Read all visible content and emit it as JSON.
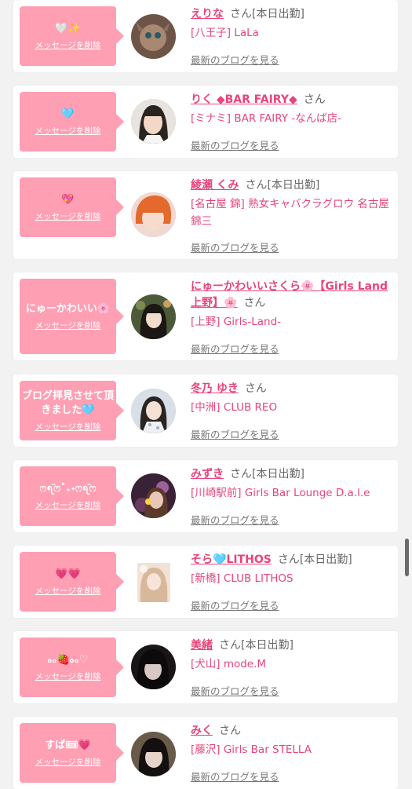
{
  "delete_label": "メッセージを削除",
  "blog_label": "最新のブログを見る",
  "san_label": "さん",
  "colors": {
    "accent": "#e8457a",
    "bubble": "#ff9fb4",
    "background": "#f2f2f2"
  },
  "cards": [
    {
      "message": "🤍✨",
      "name": "えりな",
      "badge": "[本日出勤]",
      "shop": "[八王子] LaLa"
    },
    {
      "message": "🩵",
      "name": "りく ◆BAR FAIRY◆",
      "badge": "",
      "shop": "[ミナミ] BAR FAIRY -なんば店-"
    },
    {
      "message": "💖",
      "name": "綾瀬 くみ",
      "badge": "[本日出勤]",
      "shop": "[名古屋 錦] 熟女キャバクラグロウ 名古屋錦三"
    },
    {
      "message": "にゅーかわいい🌸",
      "name": "にゅーかわいいさくら🌸【Girls Land 上野】🌸",
      "badge": "",
      "shop": "[上野] Girls-Land-"
    },
    {
      "message": "ブログ拝見させて頂きました🩵",
      "name": "冬乃 ゆき",
      "badge": "",
      "shop": "[中洲] CLUB REO"
    },
    {
      "message": "ෆ᪇̈ෆ˚₊˖ෆ᪇̈ෆ",
      "name": "みずき",
      "badge": "[本日出勤]",
      "shop": "[川崎駅前] Girls Bar Lounge D.a.l.e"
    },
    {
      "message": "💗💗",
      "name": "そら🩵LITHOS",
      "badge": "[本日出勤]",
      "shop": "[新橋] CLUB LITHOS"
    },
    {
      "message": "₀ₒ🍓₀ₒ♡",
      "name": "美緒",
      "badge": "[本日出勤]",
      "shop": "[犬山] mode.M"
    },
    {
      "message": "すぱ🎟💗",
      "name": "みく",
      "badge": "",
      "shop": "[藤沢] Girls Bar STELLA"
    }
  ]
}
